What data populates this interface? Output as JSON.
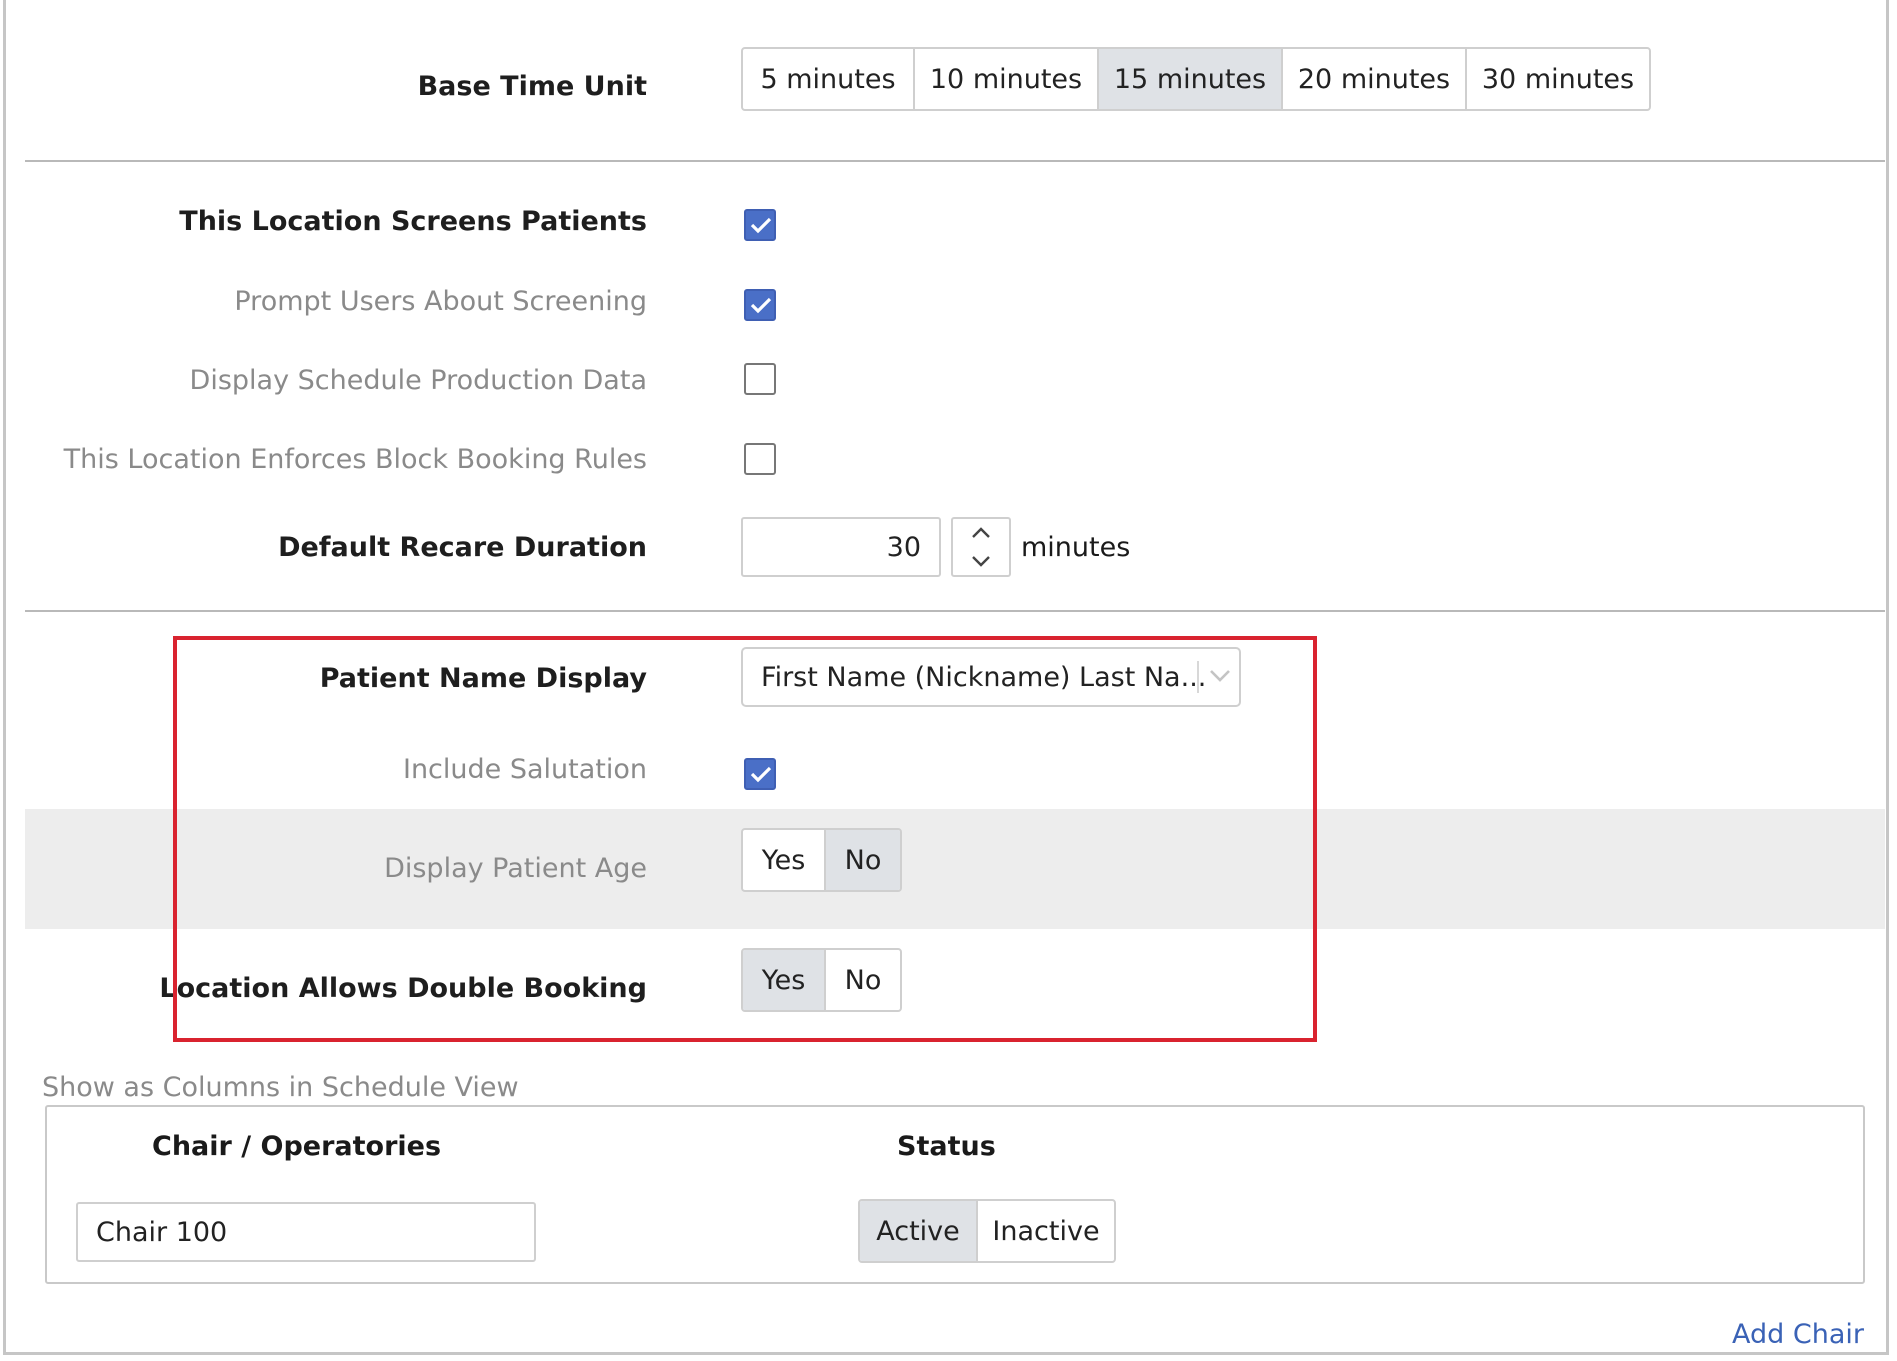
{
  "base_time_unit": {
    "label": "Base Time Unit",
    "options": [
      "5 minutes",
      "10 minutes",
      "15 minutes",
      "20 minutes",
      "30 minutes"
    ],
    "selected": "15 minutes"
  },
  "screening": {
    "screens_patients": {
      "label": "This Location Screens Patients",
      "checked": true
    },
    "prompt_users": {
      "label": "Prompt Users About Screening",
      "checked": true
    },
    "display_production": {
      "label": "Display Schedule Production Data",
      "checked": false
    },
    "enforce_block_booking": {
      "label": "This Location Enforces Block Booking Rules",
      "checked": false
    }
  },
  "recare": {
    "label": "Default Recare Duration",
    "value": "30",
    "unit": "minutes"
  },
  "patient_name": {
    "label": "Patient Name Display",
    "selected": "First Name (Nickname) Last Na..."
  },
  "salutation": {
    "label": "Include Salutation",
    "checked": true
  },
  "patient_age": {
    "label": "Display Patient Age",
    "yes": "Yes",
    "no": "No",
    "selected": "No"
  },
  "double_booking": {
    "label": "Location Allows Double Booking",
    "yes": "Yes",
    "no": "No",
    "selected": "Yes"
  },
  "columns": {
    "legend": "Show as Columns in Schedule View",
    "chair_header": "Chair / Operatories",
    "status_header": "Status",
    "chair_value": "Chair 100",
    "status_active": "Active",
    "status_inactive": "Inactive",
    "status_selected": "Active",
    "add_chair": "Add Chair"
  },
  "colors": {
    "accent": "#4a6fc7",
    "highlight": "#d9232f",
    "link": "#3a62b6"
  }
}
